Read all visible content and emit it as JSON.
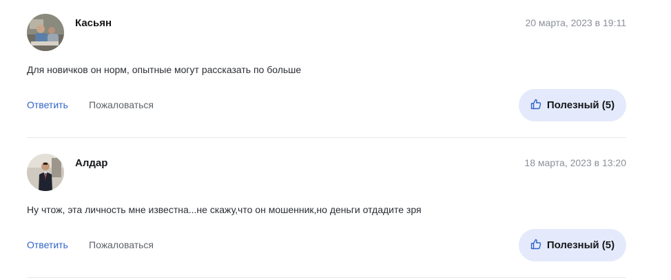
{
  "colors": {
    "link": "#2f63c9",
    "useful_bg": "#e4eafb",
    "divider": "#e6e8ec",
    "muted": "#8b8f97"
  },
  "comments": [
    {
      "author": "Касьян",
      "date": "20 марта, 2023 в 19:11",
      "text": "Для новичков он норм, опытные могут рассказать по больше",
      "reply_label": "Ответить",
      "report_label": "Пожаловаться",
      "useful_label": "Полезный (5)",
      "useful_icon": "thumbs-up-icon"
    },
    {
      "author": "Алдар",
      "date": "18 марта, 2023 в 13:20",
      "text": "Ну чтож, эта личность мне известна...не скажу,что он мошенник,но деньги отдадите зря",
      "reply_label": "Ответить",
      "report_label": "Пожаловаться",
      "useful_label": "Полезный (5)",
      "useful_icon": "thumbs-up-icon"
    }
  ]
}
